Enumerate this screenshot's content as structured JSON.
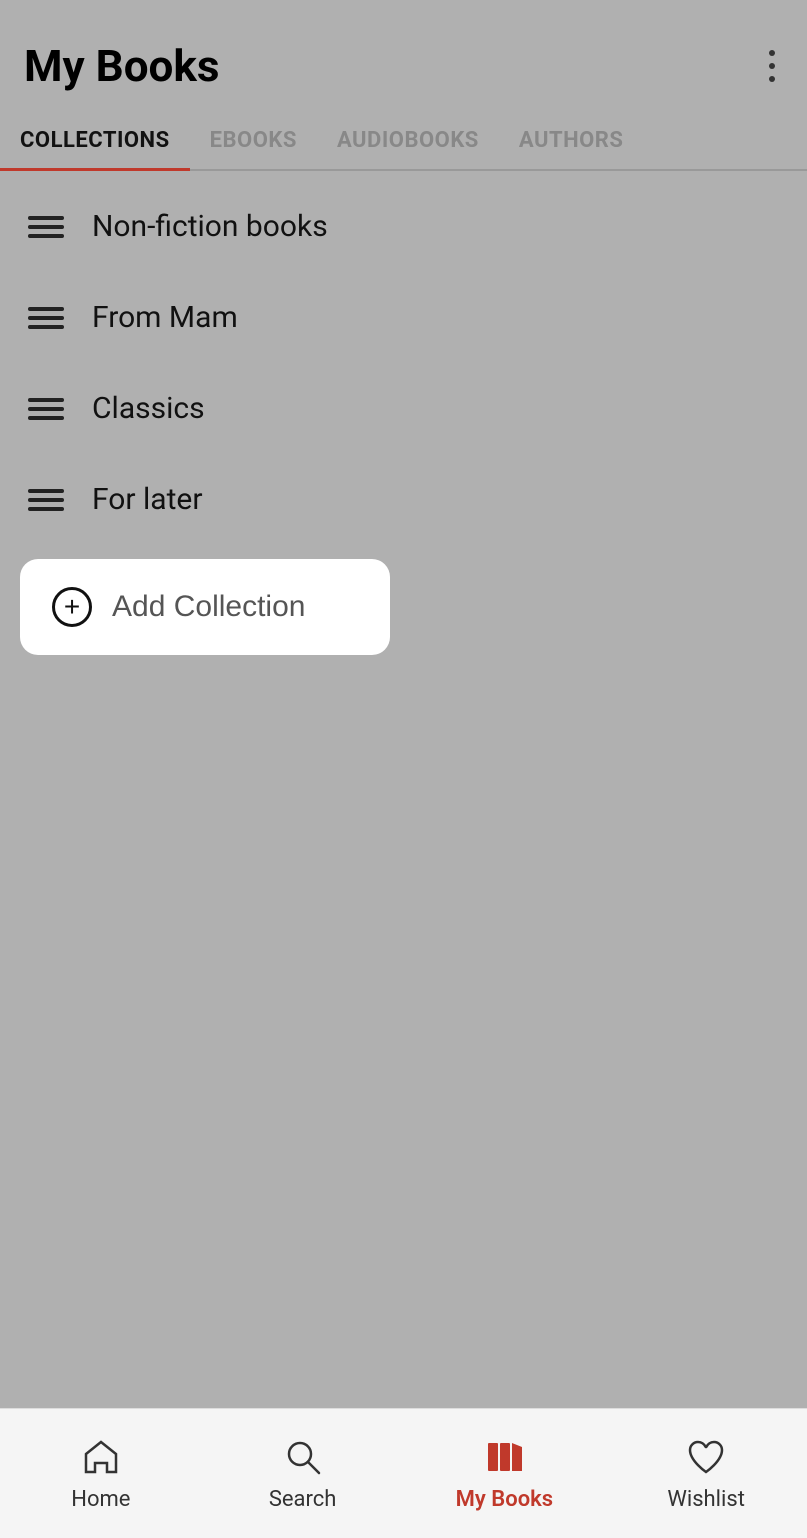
{
  "header": {
    "title": "My Books",
    "menu_icon": "three-dots-vertical-icon"
  },
  "tabs": [
    {
      "id": "collections",
      "label": "COLLECTIONS",
      "active": true
    },
    {
      "id": "ebooks",
      "label": "EBOOKS",
      "active": false
    },
    {
      "id": "audiobooks",
      "label": "AUDIOBOOKS",
      "active": false
    },
    {
      "id": "authors",
      "label": "AUTHORS",
      "active": false
    }
  ],
  "collections": [
    {
      "id": 1,
      "name": "Non-fiction books"
    },
    {
      "id": 2,
      "name": "From Mam"
    },
    {
      "id": 3,
      "name": "Classics"
    },
    {
      "id": 4,
      "name": "For later"
    }
  ],
  "add_collection": {
    "label": "Add Collection"
  },
  "bottom_nav": [
    {
      "id": "home",
      "label": "Home",
      "active": false
    },
    {
      "id": "search",
      "label": "Search",
      "active": false
    },
    {
      "id": "my-books",
      "label": "My Books",
      "active": true
    },
    {
      "id": "wishlist",
      "label": "Wishlist",
      "active": false
    }
  ]
}
